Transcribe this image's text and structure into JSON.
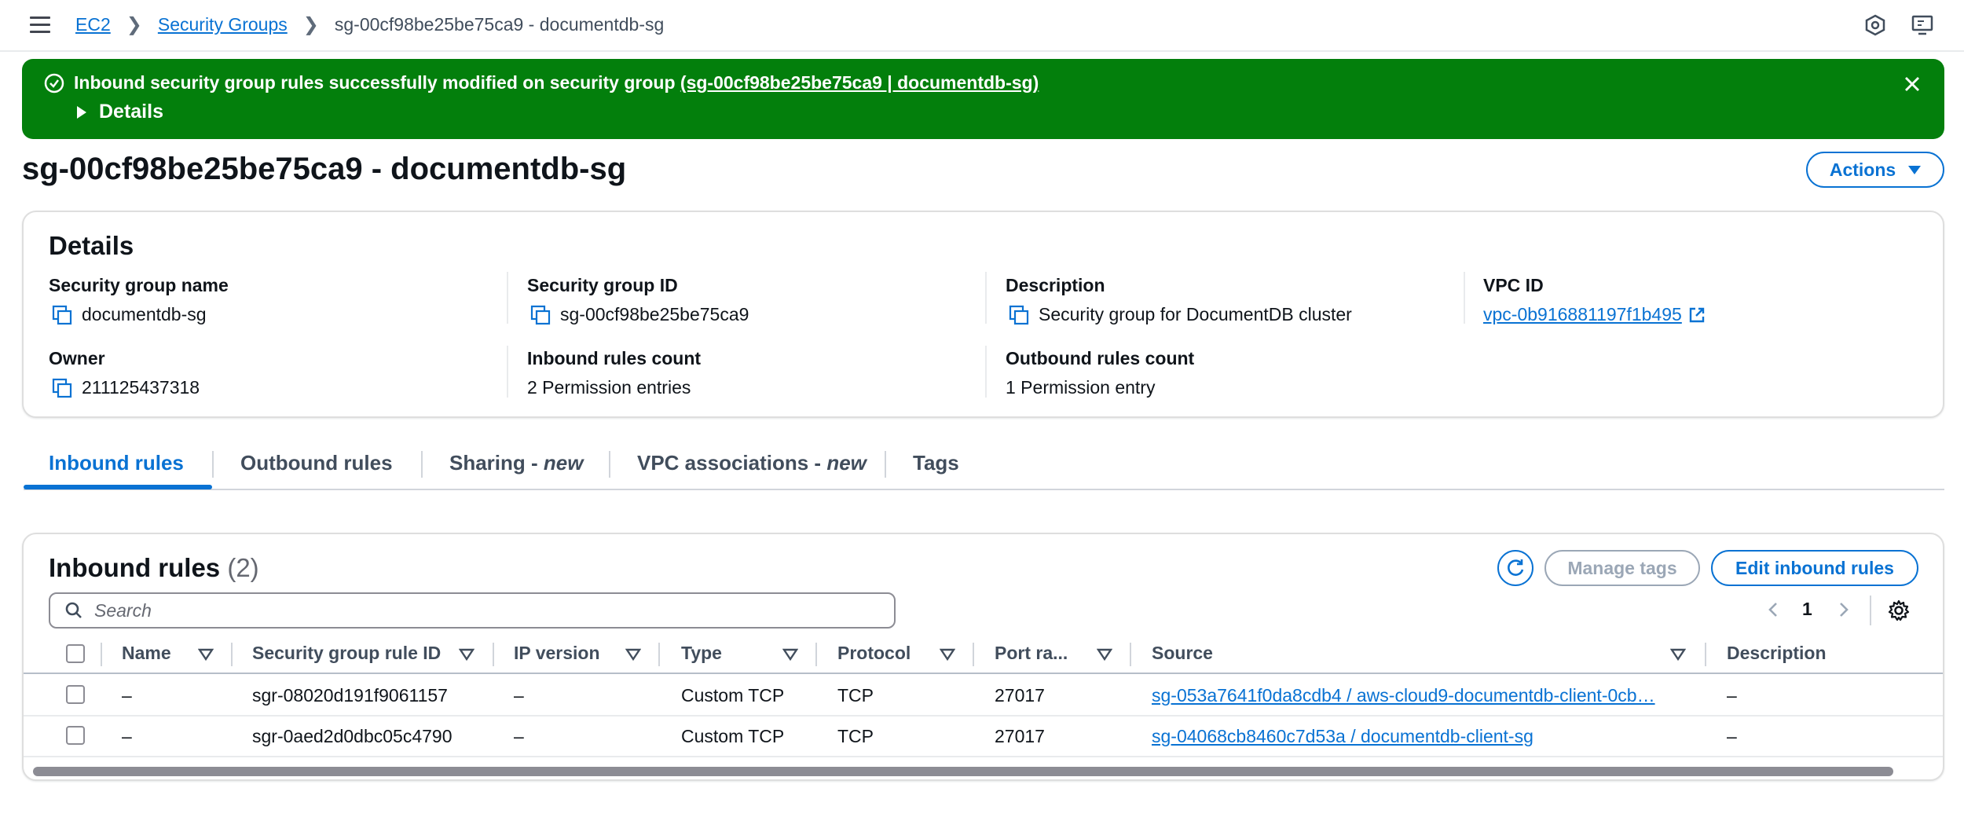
{
  "breadcrumb": {
    "items": [
      "EC2",
      "Security Groups"
    ],
    "current": "sg-00cf98be25be75ca9 - documentdb-sg"
  },
  "flash": {
    "message": "Inbound security group rules successfully modified on security group ",
    "link": "(sg-00cf98be25be75ca9 | documentdb-sg)",
    "details_label": "Details",
    "color": "#037f0c"
  },
  "page": {
    "title": "sg-00cf98be25be75ca9 - documentdb-sg",
    "actions_label": "Actions"
  },
  "details": {
    "heading": "Details",
    "fields": {
      "sg_name": {
        "label": "Security group name",
        "value": "documentdb-sg"
      },
      "sg_id": {
        "label": "Security group ID",
        "value": "sg-00cf98be25be75ca9"
      },
      "description": {
        "label": "Description",
        "value": "Security group for DocumentDB cluster"
      },
      "vpc_id": {
        "label": "VPC ID",
        "value": "vpc-0b916881197f1b495"
      },
      "owner": {
        "label": "Owner",
        "value": "211125437318"
      },
      "inbound_count": {
        "label": "Inbound rules count",
        "value": "2 Permission entries"
      },
      "outbound_count": {
        "label": "Outbound rules count",
        "value": "1 Permission entry"
      }
    }
  },
  "tabs": [
    {
      "label": "Inbound rules",
      "suffix": ""
    },
    {
      "label": "Outbound rules",
      "suffix": ""
    },
    {
      "label": "Sharing - ",
      "suffix": "new"
    },
    {
      "label": "VPC associations - ",
      "suffix": "new"
    },
    {
      "label": "Tags",
      "suffix": ""
    }
  ],
  "rules": {
    "title": "Inbound rules",
    "count": "(2)",
    "manage_tags_label": "Manage tags",
    "edit_label": "Edit inbound rules",
    "search_placeholder": "Search",
    "page_number": "1",
    "columns": [
      "Name",
      "Security group rule ID",
      "IP version",
      "Type",
      "Protocol",
      "Port ra...",
      "Source",
      "Description"
    ],
    "rows": [
      {
        "name": "–",
        "rule_id": "sgr-08020d191f9061157",
        "ip_version": "–",
        "type": "Custom TCP",
        "protocol": "TCP",
        "port": "27017",
        "source": "sg-053a7641f0da8cdb4 / aws-cloud9-documentdb-client-0cb…",
        "description": "–"
      },
      {
        "name": "–",
        "rule_id": "sgr-0aed2d0dbc05c4790",
        "ip_version": "–",
        "type": "Custom TCP",
        "protocol": "TCP",
        "port": "27017",
        "source": "sg-04068cb8460c7d53a / documentdb-client-sg",
        "description": "–"
      }
    ]
  },
  "colors": {
    "link": "#0972d3",
    "success": "#037f0c"
  }
}
